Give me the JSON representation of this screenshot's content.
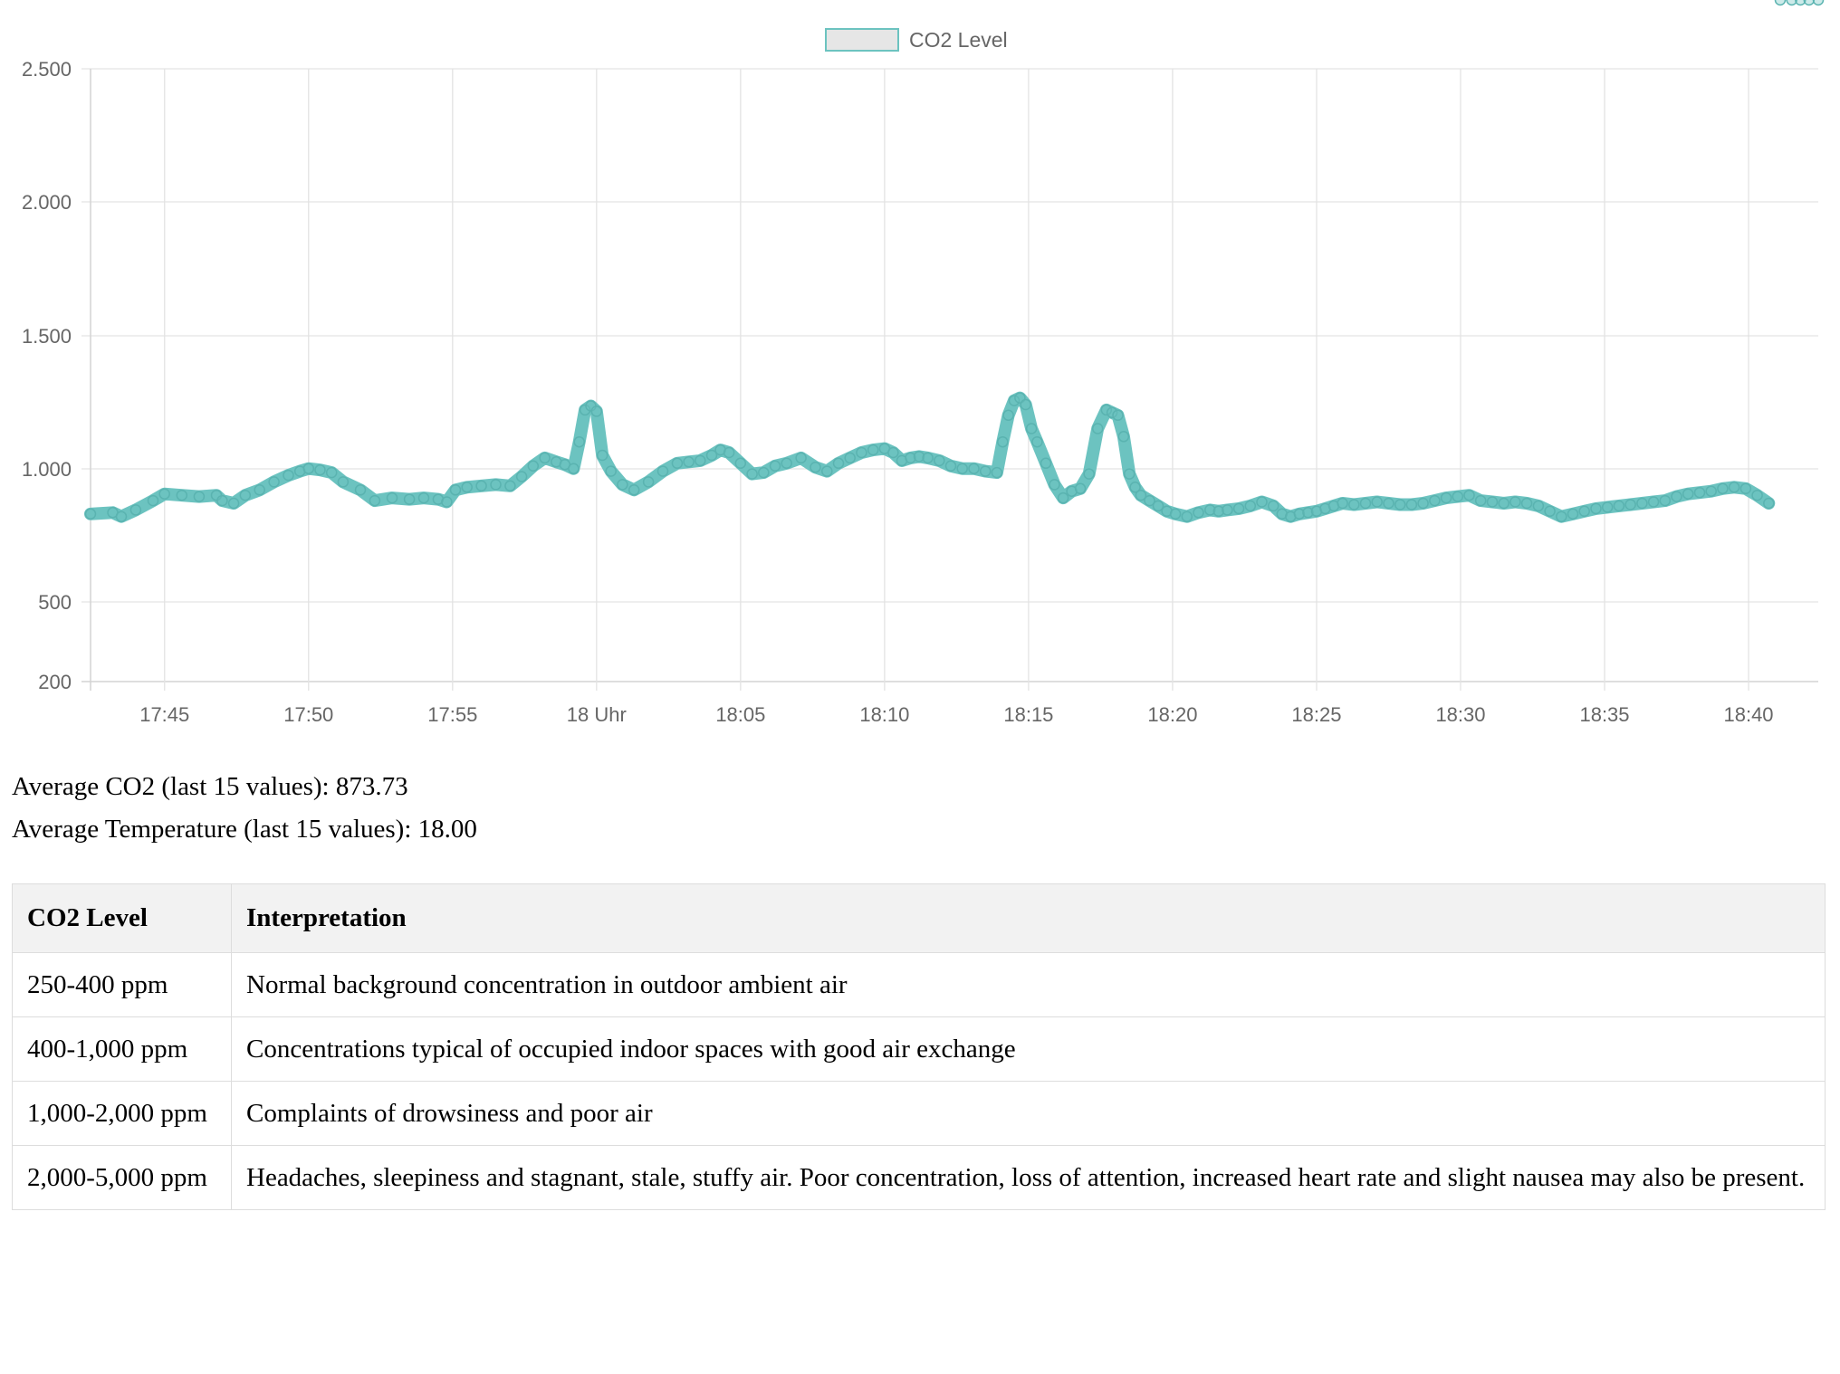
{
  "chart_data": {
    "type": "line",
    "legend": {
      "label": "CO2 Level",
      "position": "top-center"
    },
    "series_color": "#6cc3c0",
    "y_ticks": [
      "2.500",
      "2.000",
      "1.500",
      "1.000",
      "500",
      "200"
    ],
    "y_tick_values": [
      2500,
      2000,
      1500,
      1000,
      500,
      200
    ],
    "ylim": [
      200,
      2500
    ],
    "x_ticks": [
      "17:45",
      "17:50",
      "17:55",
      "18 Uhr",
      "18:05",
      "18:10",
      "18:15",
      "18:20",
      "18:25",
      "18:30",
      "18:35",
      "18:40"
    ],
    "x_tick_minutes": [
      1065,
      1070,
      1075,
      1080,
      1085,
      1090,
      1095,
      1100,
      1105,
      1110,
      1115,
      1120
    ],
    "xlim_minutes": [
      1062.43,
      1122.42
    ],
    "grid": true,
    "series": [
      {
        "name": "CO2 Level",
        "x_minutes": [
          1062.43,
          1063.2,
          1063.5,
          1064.0,
          1064.6,
          1065.0,
          1065.6,
          1066.2,
          1066.8,
          1067.0,
          1067.4,
          1067.8,
          1068.3,
          1068.8,
          1069.3,
          1069.7,
          1070.0,
          1070.4,
          1070.8,
          1071.2,
          1071.8,
          1072.3,
          1072.9,
          1073.5,
          1074.0,
          1074.5,
          1074.8,
          1075.1,
          1075.5,
          1076.0,
          1076.5,
          1077.0,
          1077.4,
          1077.8,
          1078.2,
          1078.6,
          1078.9,
          1079.2,
          1079.4,
          1079.6,
          1079.8,
          1080.0,
          1080.2,
          1080.5,
          1080.9,
          1081.3,
          1081.8,
          1082.3,
          1082.8,
          1083.2,
          1083.6,
          1084.0,
          1084.3,
          1084.6,
          1085.0,
          1085.4,
          1085.8,
          1086.2,
          1086.6,
          1087.1,
          1087.6,
          1088.0,
          1088.4,
          1088.8,
          1089.2,
          1089.6,
          1090.0,
          1090.3,
          1090.6,
          1090.9,
          1091.2,
          1091.5,
          1091.9,
          1092.3,
          1092.7,
          1093.1,
          1093.5,
          1093.9,
          1094.1,
          1094.3,
          1094.5,
          1094.7,
          1094.9,
          1095.1,
          1095.3,
          1095.6,
          1095.9,
          1096.2,
          1096.5,
          1096.8,
          1097.1,
          1097.4,
          1097.7,
          1097.9,
          1098.1,
          1098.3,
          1098.5,
          1098.7,
          1098.9,
          1099.2,
          1099.5,
          1099.8,
          1100.1,
          1100.5,
          1100.9,
          1101.3,
          1101.6,
          1101.9,
          1102.3,
          1102.7,
          1103.1,
          1103.5,
          1103.8,
          1104.1,
          1104.4,
          1104.7,
          1105.0,
          1105.3,
          1105.6,
          1105.9,
          1106.3,
          1106.7,
          1107.1,
          1107.5,
          1107.9,
          1108.3,
          1108.7,
          1109.1,
          1109.5,
          1109.9,
          1110.3,
          1110.7,
          1111.1,
          1111.5,
          1111.9,
          1112.3,
          1112.7,
          1113.1,
          1113.5,
          1113.9,
          1114.3,
          1114.7,
          1115.1,
          1115.5,
          1115.9,
          1116.3,
          1116.7,
          1117.1,
          1117.5,
          1117.9,
          1118.3,
          1118.7,
          1119.1,
          1119.5,
          1119.9,
          1120.3,
          1120.7,
          1121.1,
          1121.5,
          1121.8,
          1122.1,
          1122.42
        ],
        "values": [
          830,
          835,
          820,
          845,
          880,
          905,
          900,
          895,
          900,
          880,
          870,
          900,
          920,
          950,
          975,
          990,
          1000,
          995,
          985,
          950,
          920,
          880,
          890,
          885,
          890,
          885,
          875,
          920,
          930,
          935,
          940,
          935,
          970,
          1010,
          1040,
          1025,
          1015,
          1000,
          1100,
          1220,
          1235,
          1215,
          1050,
          990,
          940,
          920,
          950,
          990,
          1020,
          1025,
          1030,
          1050,
          1070,
          1060,
          1020,
          980,
          985,
          1010,
          1020,
          1040,
          1005,
          990,
          1020,
          1040,
          1060,
          1070,
          1075,
          1060,
          1030,
          1040,
          1045,
          1040,
          1030,
          1010,
          1000,
          1000,
          990,
          985,
          1100,
          1200,
          1255,
          1265,
          1240,
          1150,
          1100,
          1020,
          940,
          890,
          915,
          925,
          980,
          1150,
          1220,
          1210,
          1200,
          1120,
          980,
          930,
          900,
          880,
          860,
          840,
          830,
          820,
          835,
          845,
          840,
          845,
          850,
          860,
          875,
          860,
          830,
          820,
          830,
          835,
          840,
          850,
          860,
          870,
          865,
          870,
          875,
          870,
          865,
          865,
          870,
          880,
          890,
          895,
          900,
          880,
          875,
          870,
          875,
          870,
          860,
          840,
          820,
          830,
          840,
          850,
          855,
          860,
          865,
          870,
          875,
          880,
          895,
          905,
          910,
          915,
          925,
          930,
          925,
          900,
          870
        ]
      }
    ]
  },
  "stats": {
    "avg_co2": "Average CO2 (last 15 values): 873.73",
    "avg_temp": "Average Temperature (last 15 values): 18.00"
  },
  "table": {
    "headers": [
      "CO2 Level",
      "Interpretation"
    ],
    "rows": [
      {
        "level": "250-400 ppm",
        "interpretation": "Normal background concentration in outdoor ambient air"
      },
      {
        "level": "400-1,000 ppm",
        "interpretation": "Concentrations typical of occupied indoor spaces with good air exchange"
      },
      {
        "level": "1,000-2,000 ppm",
        "interpretation": "Complaints of drowsiness and poor air"
      },
      {
        "level": "2,000-5,000 ppm",
        "interpretation": "Headaches, sleepiness and stagnant, stale, stuffy air. Poor concentration, loss of attention, increased heart rate and slight nausea may also be present."
      }
    ]
  }
}
